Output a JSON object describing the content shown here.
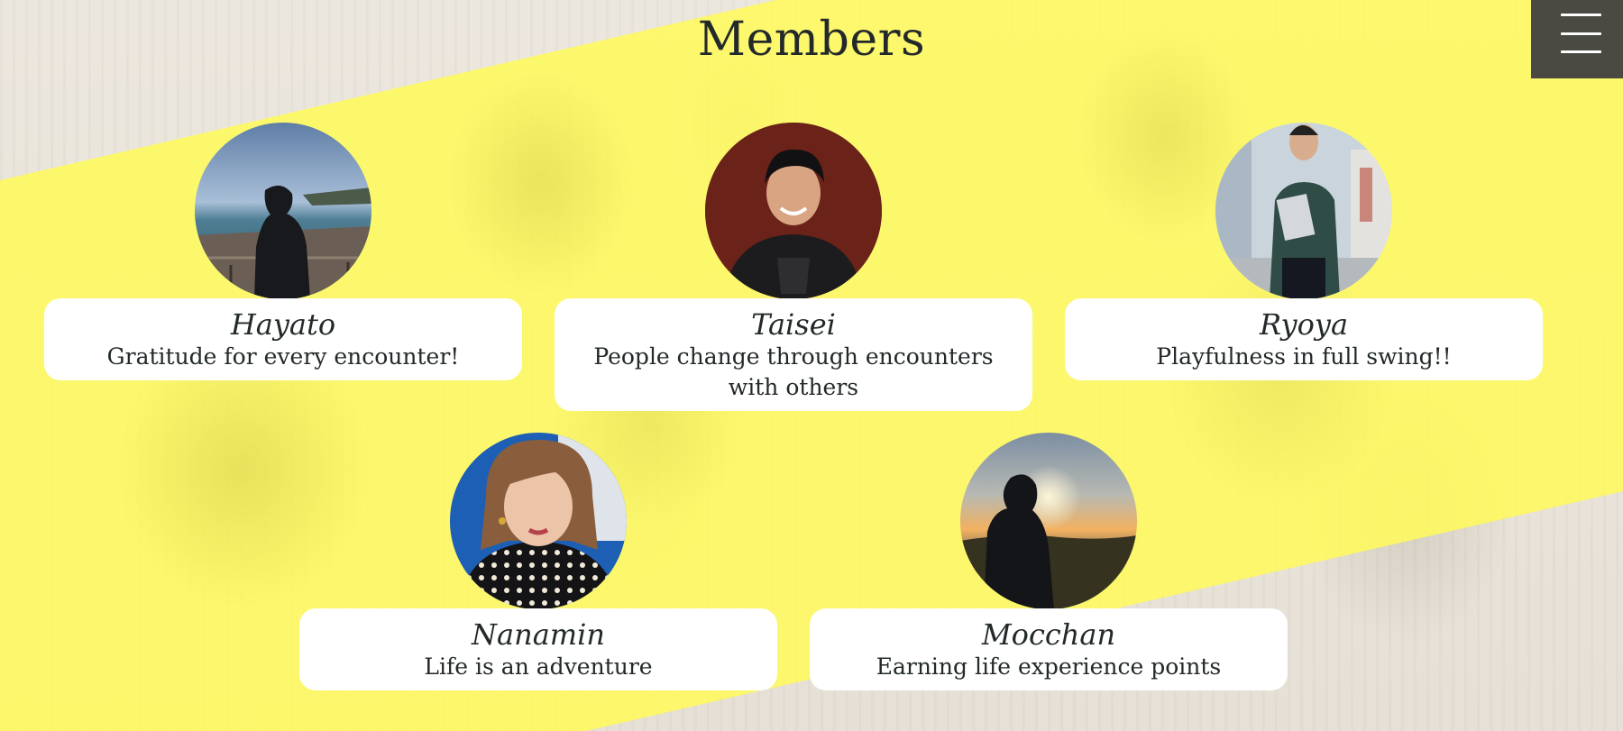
{
  "page": {
    "title": "Members"
  },
  "menu": {
    "icon": "hamburger-menu-icon",
    "background": "#4a4a43"
  },
  "theme": {
    "accent_yellow": "#fffa5a",
    "text_color": "#23292a",
    "card_background": "#ffffff"
  },
  "members": [
    {
      "name": "Hayato",
      "motto": "Gratitude for every encounter!",
      "photo": "person-by-sea-photo"
    },
    {
      "name": "Taisei",
      "motto": "People change through encounters with others",
      "photo": "smiling-man-portrait-photo"
    },
    {
      "name": "Ryoya",
      "motto": "Playfulness in full swing!!",
      "photo": "man-holding-laptop-photo"
    },
    {
      "name": "Nanamin",
      "motto": "Life is an adventure",
      "photo": "woman-selfie-photo"
    },
    {
      "name": "Mocchan",
      "motto": "Earning life experience points",
      "photo": "silhouette-at-sunset-photo"
    }
  ]
}
